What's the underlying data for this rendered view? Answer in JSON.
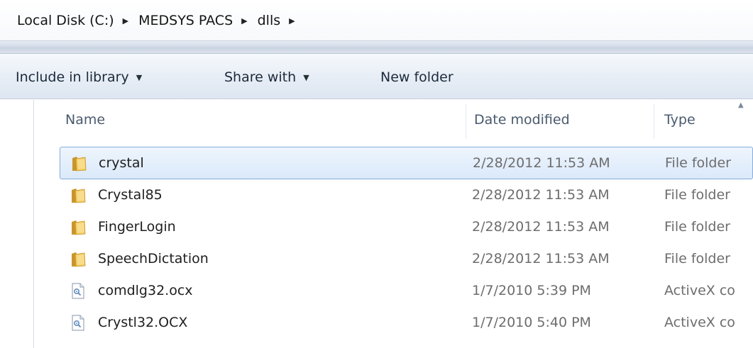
{
  "breadcrumb": {
    "items": [
      "Local Disk (C:)",
      "MEDSYS PACS",
      "dlls"
    ],
    "separator_icon": "right-triangle"
  },
  "toolbar": {
    "include_in_library": "Include in library",
    "share_with": "Share with",
    "new_folder": "New folder",
    "dropdown_icon": "down-triangle"
  },
  "columns": {
    "name": "Name",
    "date_modified": "Date modified",
    "type": "Type"
  },
  "files": [
    {
      "name": "crystal",
      "date": "2/28/2012 11:53 AM",
      "type": "File folder",
      "icon": "folder-icon",
      "selected": true
    },
    {
      "name": "Crystal85",
      "date": "2/28/2012 11:53 AM",
      "type": "File folder",
      "icon": "folder-icon",
      "selected": false
    },
    {
      "name": "FingerLogin",
      "date": "2/28/2012 11:53 AM",
      "type": "File folder",
      "icon": "folder-icon",
      "selected": false
    },
    {
      "name": "SpeechDictation",
      "date": "2/28/2012 11:53 AM",
      "type": "File folder",
      "icon": "folder-icon",
      "selected": false
    },
    {
      "name": "comdlg32.ocx",
      "date": "1/7/2010 5:39 PM",
      "type": "ActiveX co",
      "icon": "activex-file-icon",
      "selected": false
    },
    {
      "name": "Crystl32.OCX",
      "date": "1/7/2010 5:40 PM",
      "type": "ActiveX co",
      "icon": "activex-file-icon",
      "selected": false
    }
  ],
  "colors": {
    "selection_border": "#84acdd",
    "selection_fill": "#dbe9fa",
    "folder": "#e8b84a"
  }
}
